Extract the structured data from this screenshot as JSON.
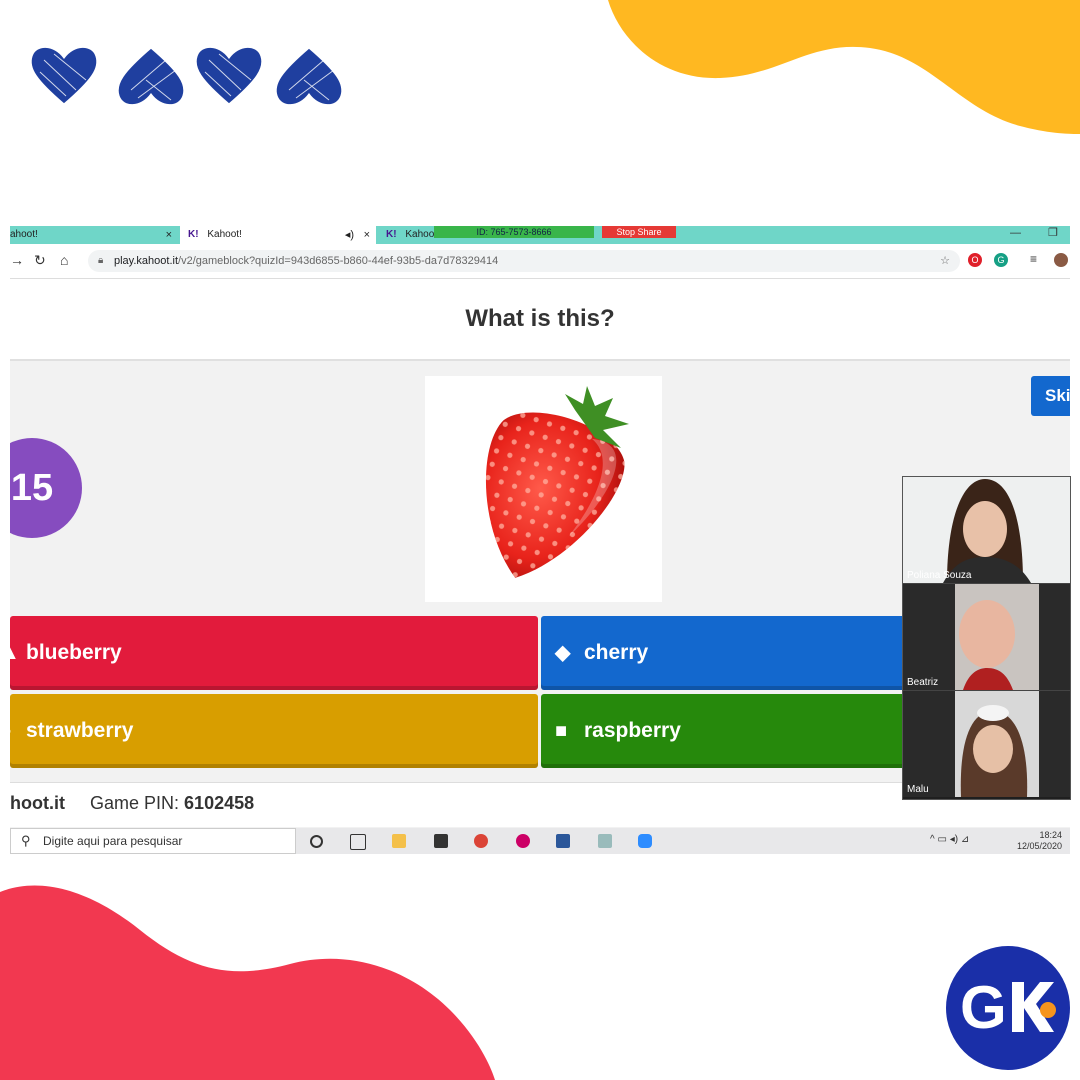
{
  "browser": {
    "tabs": [
      {
        "label": "ahoot!",
        "close": "×"
      },
      {
        "label": "Kahoot!",
        "icon": "K!",
        "close": "×"
      },
      {
        "label": "Kahoo",
        "icon": "K!"
      }
    ],
    "zoom_meeting_id": "ID: 765-7573-8666",
    "stop_share_label": "Stop Share",
    "url_host": "play.kahoot.it",
    "url_path": "/v2/gameblock?quizId=943d6855-b860-44ef-93b5-da7d78329414"
  },
  "question": {
    "title": "What is this?",
    "timer": "15",
    "skip_label": "Ski",
    "image": "strawberry"
  },
  "answers": [
    {
      "label": "blueberry",
      "color": "#e21b3c",
      "shape": "triangle"
    },
    {
      "label": "cherry",
      "color": "#1368ce",
      "shape": "diamond"
    },
    {
      "label": "strawberry",
      "color": "#d89e00",
      "shape": "circle"
    },
    {
      "label": "raspberry",
      "color": "#26890c",
      "shape": "square"
    }
  ],
  "footer": {
    "brand": "hoot.it",
    "pin_label": "Game PIN:",
    "pin_value": "6102458"
  },
  "taskbar": {
    "search_placeholder": "Digite aqui para pesquisar",
    "time": "18:24",
    "date": "12/05/2020"
  },
  "video_participants": [
    {
      "name": "Poliana Souza"
    },
    {
      "name": "Beatriz"
    },
    {
      "name": "Malu"
    }
  ],
  "colors": {
    "blob_yellow": "#ffb821",
    "blob_red": "#f23850",
    "hearts_blue": "#1f3f9f",
    "logo_blue": "#1a2fa8",
    "logo_orange": "#f7941d",
    "timer_purple": "#864cbf"
  }
}
